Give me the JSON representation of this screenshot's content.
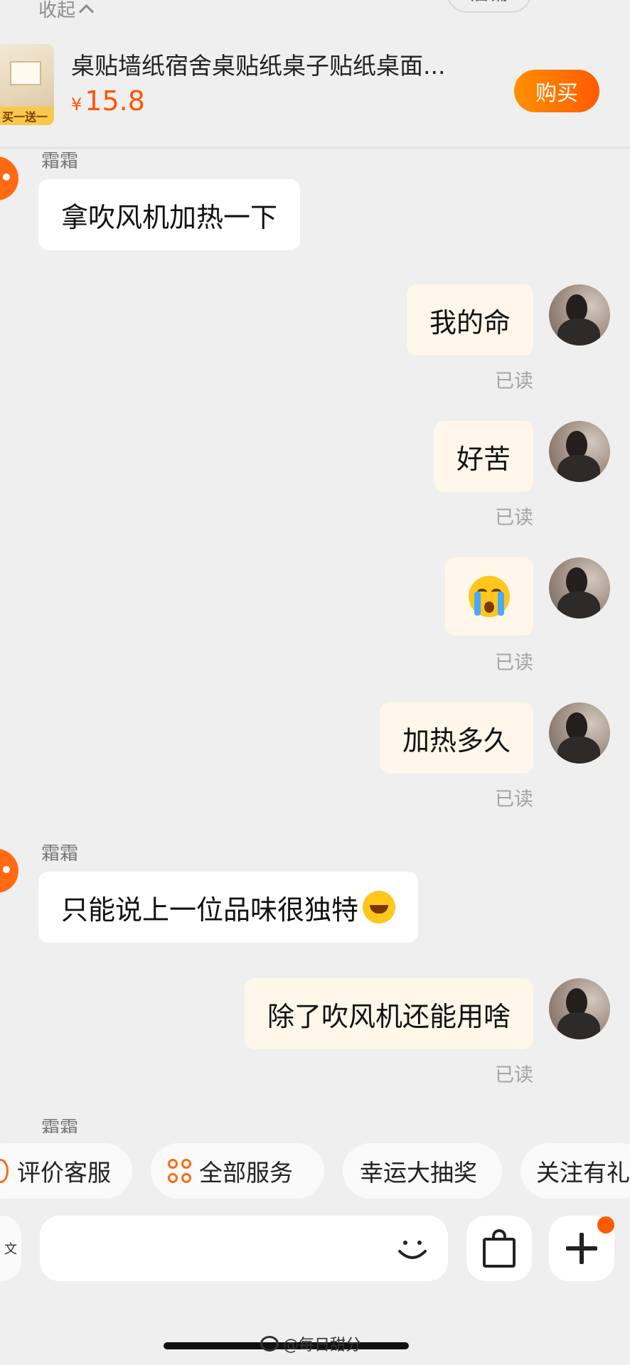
{
  "product_bar": {
    "collapse_label": "收起",
    "shop_label": "店铺",
    "thumb_badge": "买一送一",
    "title": "桌贴墙纸宿舍桌贴纸桌子贴纸桌面...",
    "currency": "¥",
    "price": "15.8",
    "buy_label": "购买"
  },
  "messages": [
    {
      "side": "left",
      "sender": "霜霜",
      "text": "拿吹风机加热一下"
    },
    {
      "side": "right",
      "text": "我的命",
      "status": "已读"
    },
    {
      "side": "right",
      "text": "好苦",
      "status": "已读"
    },
    {
      "side": "right",
      "emoji": "crying-emoji",
      "status": "已读"
    },
    {
      "side": "right",
      "text": "加热多久",
      "status": "已读"
    },
    {
      "side": "left",
      "sender": "霜霜",
      "text": "只能说上一位品味很独特",
      "emoji": "laughing-emoji"
    },
    {
      "side": "right",
      "text": "除了吹风机还能用啥",
      "status": "已读"
    },
    {
      "side": "left",
      "sender": "霜霜"
    }
  ],
  "quick_actions": [
    "评价客服",
    "全部服务",
    "幸运大抽奖",
    "关注有礼"
  ],
  "input_bar": {
    "left_key": "文",
    "icons": [
      "smile-icon",
      "shopping-bag-icon",
      "plus-icon"
    ]
  },
  "watermark": "@每日甜分",
  "colors": {
    "accent": "#ff5a00",
    "bubble_self": "#fff7e9",
    "bubble_other": "#ffffff",
    "background": "#efefef"
  }
}
